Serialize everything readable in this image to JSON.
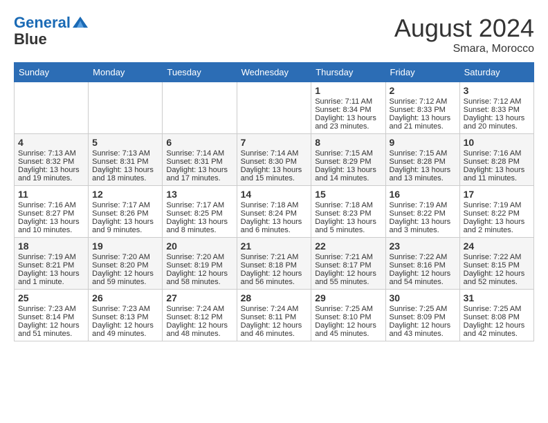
{
  "logo": {
    "line1": "General",
    "line2": "Blue"
  },
  "title": "August 2024",
  "location": "Smara, Morocco",
  "days_of_week": [
    "Sunday",
    "Monday",
    "Tuesday",
    "Wednesday",
    "Thursday",
    "Friday",
    "Saturday"
  ],
  "weeks": [
    [
      {
        "day": "",
        "content": ""
      },
      {
        "day": "",
        "content": ""
      },
      {
        "day": "",
        "content": ""
      },
      {
        "day": "",
        "content": ""
      },
      {
        "day": "1",
        "content": "Sunrise: 7:11 AM\nSunset: 8:34 PM\nDaylight: 13 hours and 23 minutes."
      },
      {
        "day": "2",
        "content": "Sunrise: 7:12 AM\nSunset: 8:33 PM\nDaylight: 13 hours and 21 minutes."
      },
      {
        "day": "3",
        "content": "Sunrise: 7:12 AM\nSunset: 8:33 PM\nDaylight: 13 hours and 20 minutes."
      }
    ],
    [
      {
        "day": "4",
        "content": "Sunrise: 7:13 AM\nSunset: 8:32 PM\nDaylight: 13 hours and 19 minutes."
      },
      {
        "day": "5",
        "content": "Sunrise: 7:13 AM\nSunset: 8:31 PM\nDaylight: 13 hours and 18 minutes."
      },
      {
        "day": "6",
        "content": "Sunrise: 7:14 AM\nSunset: 8:31 PM\nDaylight: 13 hours and 17 minutes."
      },
      {
        "day": "7",
        "content": "Sunrise: 7:14 AM\nSunset: 8:30 PM\nDaylight: 13 hours and 15 minutes."
      },
      {
        "day": "8",
        "content": "Sunrise: 7:15 AM\nSunset: 8:29 PM\nDaylight: 13 hours and 14 minutes."
      },
      {
        "day": "9",
        "content": "Sunrise: 7:15 AM\nSunset: 8:28 PM\nDaylight: 13 hours and 13 minutes."
      },
      {
        "day": "10",
        "content": "Sunrise: 7:16 AM\nSunset: 8:28 PM\nDaylight: 13 hours and 11 minutes."
      }
    ],
    [
      {
        "day": "11",
        "content": "Sunrise: 7:16 AM\nSunset: 8:27 PM\nDaylight: 13 hours and 10 minutes."
      },
      {
        "day": "12",
        "content": "Sunrise: 7:17 AM\nSunset: 8:26 PM\nDaylight: 13 hours and 9 minutes."
      },
      {
        "day": "13",
        "content": "Sunrise: 7:17 AM\nSunset: 8:25 PM\nDaylight: 13 hours and 8 minutes."
      },
      {
        "day": "14",
        "content": "Sunrise: 7:18 AM\nSunset: 8:24 PM\nDaylight: 13 hours and 6 minutes."
      },
      {
        "day": "15",
        "content": "Sunrise: 7:18 AM\nSunset: 8:23 PM\nDaylight: 13 hours and 5 minutes."
      },
      {
        "day": "16",
        "content": "Sunrise: 7:19 AM\nSunset: 8:22 PM\nDaylight: 13 hours and 3 minutes."
      },
      {
        "day": "17",
        "content": "Sunrise: 7:19 AM\nSunset: 8:22 PM\nDaylight: 13 hours and 2 minutes."
      }
    ],
    [
      {
        "day": "18",
        "content": "Sunrise: 7:19 AM\nSunset: 8:21 PM\nDaylight: 13 hours and 1 minute."
      },
      {
        "day": "19",
        "content": "Sunrise: 7:20 AM\nSunset: 8:20 PM\nDaylight: 12 hours and 59 minutes."
      },
      {
        "day": "20",
        "content": "Sunrise: 7:20 AM\nSunset: 8:19 PM\nDaylight: 12 hours and 58 minutes."
      },
      {
        "day": "21",
        "content": "Sunrise: 7:21 AM\nSunset: 8:18 PM\nDaylight: 12 hours and 56 minutes."
      },
      {
        "day": "22",
        "content": "Sunrise: 7:21 AM\nSunset: 8:17 PM\nDaylight: 12 hours and 55 minutes."
      },
      {
        "day": "23",
        "content": "Sunrise: 7:22 AM\nSunset: 8:16 PM\nDaylight: 12 hours and 54 minutes."
      },
      {
        "day": "24",
        "content": "Sunrise: 7:22 AM\nSunset: 8:15 PM\nDaylight: 12 hours and 52 minutes."
      }
    ],
    [
      {
        "day": "25",
        "content": "Sunrise: 7:23 AM\nSunset: 8:14 PM\nDaylight: 12 hours and 51 minutes."
      },
      {
        "day": "26",
        "content": "Sunrise: 7:23 AM\nSunset: 8:13 PM\nDaylight: 12 hours and 49 minutes."
      },
      {
        "day": "27",
        "content": "Sunrise: 7:24 AM\nSunset: 8:12 PM\nDaylight: 12 hours and 48 minutes."
      },
      {
        "day": "28",
        "content": "Sunrise: 7:24 AM\nSunset: 8:11 PM\nDaylight: 12 hours and 46 minutes."
      },
      {
        "day": "29",
        "content": "Sunrise: 7:25 AM\nSunset: 8:10 PM\nDaylight: 12 hours and 45 minutes."
      },
      {
        "day": "30",
        "content": "Sunrise: 7:25 AM\nSunset: 8:09 PM\nDaylight: 12 hours and 43 minutes."
      },
      {
        "day": "31",
        "content": "Sunrise: 7:25 AM\nSunset: 8:08 PM\nDaylight: 12 hours and 42 minutes."
      }
    ]
  ]
}
